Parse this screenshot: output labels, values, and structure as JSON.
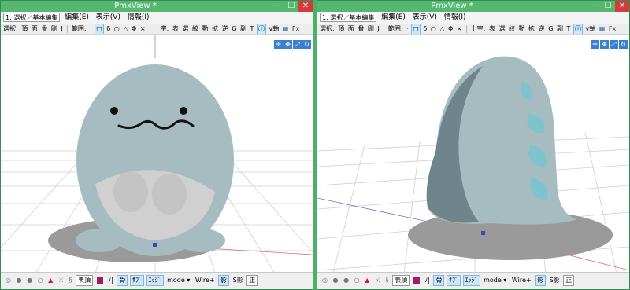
{
  "left": {
    "title": "PmxView *",
    "window_buttons": {
      "minimize": "—",
      "maximize": "☐",
      "close": "✕"
    },
    "mode_select": "1: 選択／基本編集",
    "menus": [
      "編集(E)",
      "表示(V)",
      "情報(I)"
    ],
    "toolbar": {
      "select_label": "選択:",
      "select_items": [
        "頂",
        "面",
        "骨",
        "剛",
        "J"
      ],
      "range_label": "範囲:",
      "range_items": [
        "·",
        "□",
        "δ",
        "○",
        "△",
        "Φ",
        "×"
      ],
      "cross_label": "十字:",
      "cross_items": [
        "表",
        "選",
        "絞",
        "動",
        "拡",
        "逆",
        "G",
        "副",
        "T"
      ],
      "axis_label": "v軸",
      "fx_label": "Fx"
    },
    "statusbar": {
      "expr": "表頂",
      "slash": "ﾉ|",
      "bone": "骨",
      "bone_sub": "ｻﾌﾞ",
      "edge": "ｴｯｼﾞ",
      "mode": "mode ▾",
      "wire": "Wire+",
      "shadow": "影",
      "sshadow": "S影",
      "front": "正"
    }
  },
  "right": {
    "title": "PmxView *",
    "window_buttons": {
      "minimize": "—",
      "maximize": "☐",
      "close": "✕"
    },
    "mode_select": "1: 選択／基本編集",
    "menus": [
      "編集(E)",
      "表示(V)",
      "情報(I)"
    ],
    "toolbar": {
      "select_label": "選択:",
      "select_items": [
        "頂",
        "面",
        "骨",
        "剛",
        "J"
      ],
      "range_label": "範囲:",
      "range_items": [
        "·",
        "□",
        "δ",
        "○",
        "△",
        "Φ",
        "×"
      ],
      "cross_label": "十字:",
      "cross_items": [
        "表",
        "選",
        "絞",
        "動",
        "拡",
        "逆",
        "G",
        "副",
        "T"
      ],
      "axis_label": "v軸",
      "fx_label": "Fx"
    },
    "statusbar": {
      "expr": "表頂",
      "slash": "ﾉ|",
      "bone": "骨",
      "bone_sub": "ｻﾌﾞ",
      "edge": "ｴｯｼﾞ",
      "mode": "mode ▾",
      "wire": "Wire+",
      "shadow": "影",
      "sshadow": "S影",
      "front": "正"
    }
  },
  "colors": {
    "title_bar": "#56b870",
    "close": "#d63b3b",
    "model_body": "#a7bcc0",
    "model_belly": "#d0d0d0",
    "spikes": "#7fc4cc",
    "shadow": "#9a9a9a",
    "grid": "#c8c8c8"
  }
}
